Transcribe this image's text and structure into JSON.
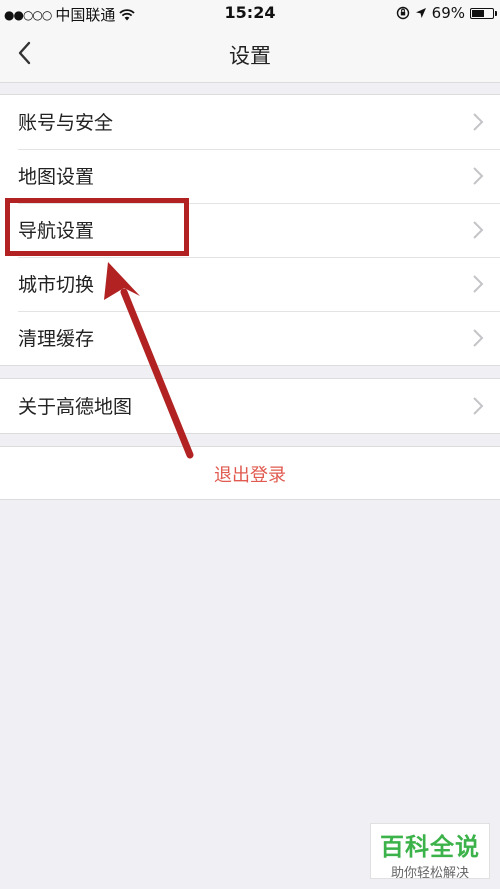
{
  "status_bar": {
    "signal": "●●○○○",
    "carrier": "中国联通",
    "time": "15:24",
    "battery": "69%",
    "battery_level": 0.69
  },
  "nav": {
    "title": "设置",
    "back_icon": "chevron-left-icon"
  },
  "groups": [
    {
      "items": [
        {
          "label": "账号与安全"
        },
        {
          "label": "地图设置"
        },
        {
          "label": "导航设置"
        },
        {
          "label": "城市切换"
        },
        {
          "label": "清理缓存"
        }
      ]
    },
    {
      "items": [
        {
          "label": "关于高德地图"
        }
      ]
    }
  ],
  "logout": {
    "label": "退出登录"
  },
  "annotation": {
    "color": "#b22222"
  },
  "watermark": {
    "brand": "百科全说",
    "slogan": "助你轻松解决"
  },
  "colors": {
    "accent": "#e05a4f",
    "background": "#efeff4"
  }
}
